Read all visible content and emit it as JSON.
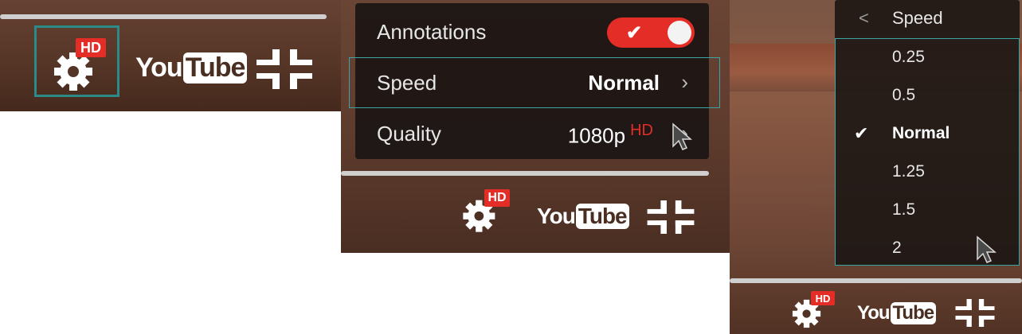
{
  "panel1": {
    "gear_badge": "HD",
    "logo_you": "You",
    "logo_tube": "Tube"
  },
  "panel2": {
    "menu": {
      "annotations_label": "Annotations",
      "speed_label": "Speed",
      "speed_value": "Normal",
      "quality_label": "Quality",
      "quality_value": "1080p",
      "quality_badge": "HD"
    },
    "gear_badge": "HD",
    "logo_you": "You",
    "logo_tube": "Tube"
  },
  "panel3": {
    "speed_menu": {
      "title": "Speed",
      "back_icon": "<",
      "options": [
        "0.25",
        "0.5",
        "Normal",
        "1.25",
        "1.5",
        "2"
      ],
      "selected": "Normal"
    },
    "gear_badge": "HD",
    "logo_you": "You",
    "logo_tube": "Tube"
  },
  "colors": {
    "accent_red": "#e52d27",
    "highlight_teal": "#2a8b89"
  },
  "icons": [
    "gear-icon",
    "fullscreen-exit-icon",
    "chevron-right-icon",
    "checkmark-icon",
    "mouse-cursor-icon"
  ]
}
